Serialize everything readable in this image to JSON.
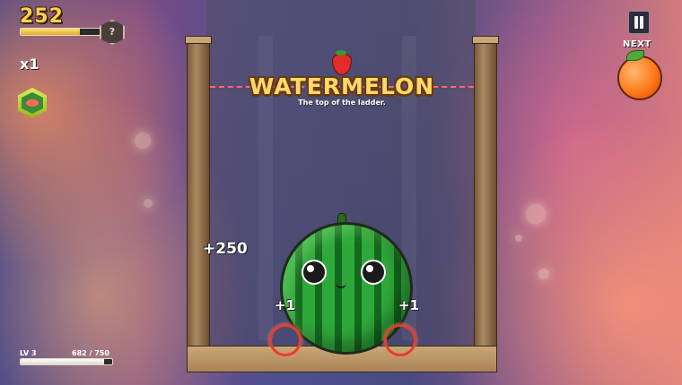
{
  "hud": {
    "score": "252",
    "score_progress": 0.75,
    "help_label": "?",
    "multiplier": "x1",
    "pause_label": "pause",
    "next_label": "NEXT",
    "next_fruit": "orange"
  },
  "level": {
    "label": "LV 3",
    "xp": "682 / 750",
    "xp_progress": 0.91
  },
  "board": {
    "goal_fruit_icon": "strawberry-icon",
    "title": "WATERMELON",
    "subtitle": "The top of the ladder.",
    "current_fruit": "watermelon"
  },
  "popups": {
    "big": "+250",
    "left": "+1",
    "right": "+1"
  },
  "colors": {
    "accent_gold": "#ffd24a",
    "danger_line": "#ff6a6a",
    "melon_green": "#2fa83a"
  }
}
